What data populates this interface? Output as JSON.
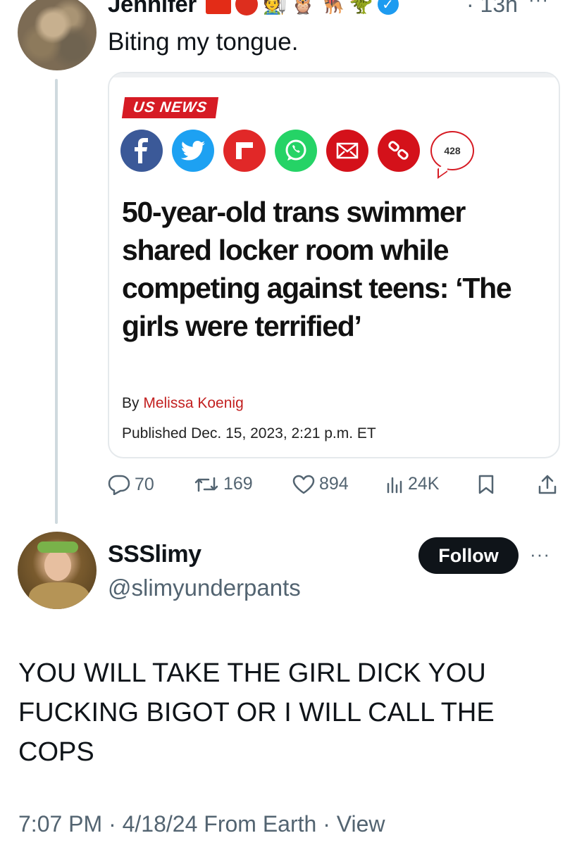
{
  "tweet1": {
    "author_name": "Jennifer",
    "emoji_icons": [
      "red-square-icon",
      "red-circle-icon",
      "farmer-emoji-icon",
      "owl-emoji-icon",
      "dog-emoji-icon",
      "dinosaur-emoji-icon"
    ],
    "emoji_glyphs": [
      "🧑‍🌾",
      "🦉",
      "🐕‍🦺",
      "🦖"
    ],
    "verified_glyph": "✓",
    "time": "· 13h",
    "more": "···",
    "text": "Biting my tongue.",
    "card": {
      "section_label": "US NEWS",
      "comment_count": "428",
      "headline": "50-year-old trans swimmer shared locker room while competing against teens: ‘The girls were terrified’",
      "byline_prefix": "By ",
      "author": "Melissa Koenig",
      "published": "Published Dec. 15, 2023, 2:21 p.m. ET"
    },
    "actions": {
      "replies": "70",
      "reposts": "169",
      "likes": "894",
      "views": "24K"
    }
  },
  "tweet2": {
    "author_name": "SSSlimy",
    "handle": "@slimyunderpants",
    "follow_label": "Follow",
    "more": "···",
    "text": "YOU WILL TAKE THE GIRL DICK YOU FUCKING BIGOT OR I WILL CALL THE COPS",
    "meta": "7:07 PM · 4/18/24 From Earth · View"
  },
  "colors": {
    "verified_blue": "#1d9bf0",
    "news_red": "#d61b24",
    "secondary_text": "#536471",
    "follow_button": "#0f1419"
  }
}
